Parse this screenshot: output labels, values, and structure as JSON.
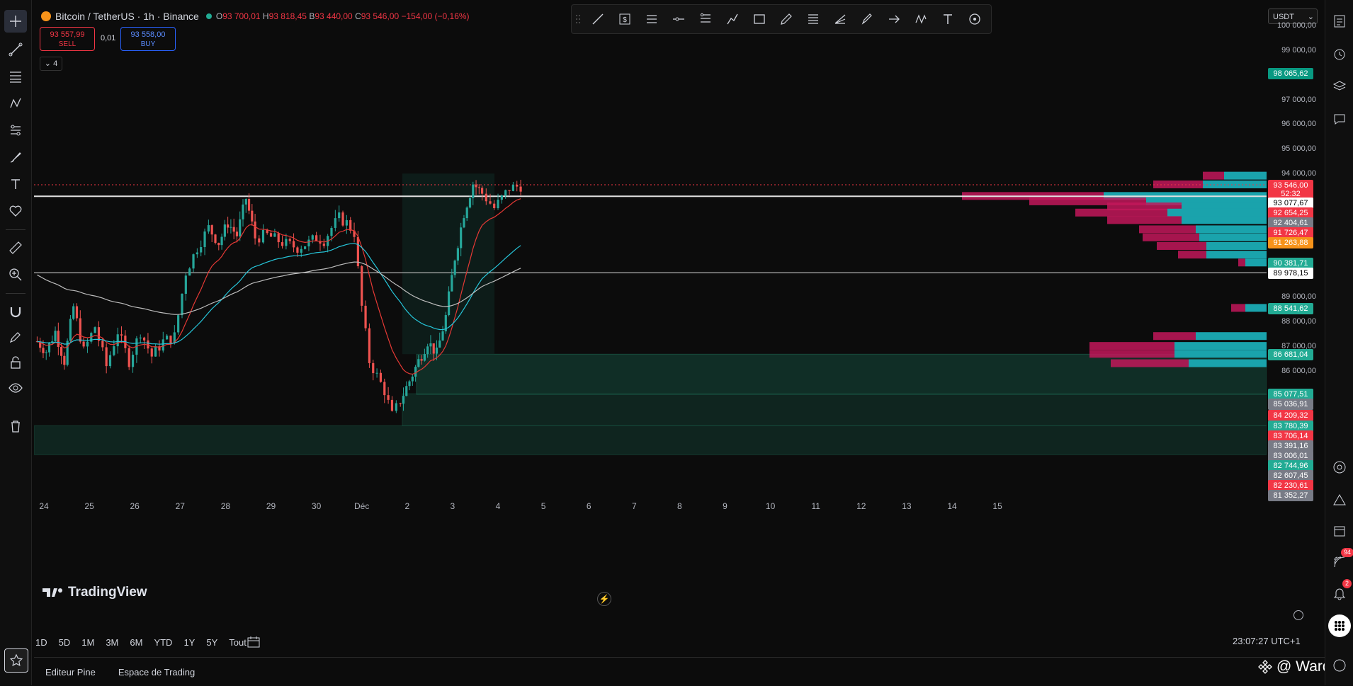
{
  "header": {
    "symbol": "Bitcoin / TetherUS · 1h · Binance",
    "open_label": "O",
    "open": "93 700,01",
    "high_label": "H",
    "high": "93 818,45",
    "low_label": "B",
    "low": "93 440,00",
    "close_label": "C",
    "close": "93 546,00",
    "change": "−154,00 (−0,16%)"
  },
  "trade": {
    "sell_price": "93 557,99",
    "sell_label": "SELL",
    "spread": "0,01",
    "buy_price": "93 558,00",
    "buy_label": "BUY"
  },
  "indicators_toggle": "4",
  "currency": "USDT",
  "price_axis": {
    "ticks": [
      "100 000,00",
      "99 000,00",
      "97 000,00",
      "96 000,00",
      "95 000,00",
      "94 000,00",
      "89 000,00",
      "88 000,00",
      "87 000,00",
      "86 000,00"
    ],
    "labels": [
      {
        "text": "98 065,62",
        "color": "#089981"
      },
      {
        "text": "93 546,00",
        "color": "#f23645"
      },
      {
        "text": "52:32",
        "color": "#f23645"
      },
      {
        "text": "93 077,67",
        "color": "#ffffff"
      },
      {
        "text": "92 654,25",
        "color": "#f23645"
      },
      {
        "text": "92 404,61",
        "color": "#787b86"
      },
      {
        "text": "91 726,47",
        "color": "#f23645"
      },
      {
        "text": "91 263,88",
        "color": "#f7931a"
      },
      {
        "text": "90 381,71",
        "color": "#22ab94"
      },
      {
        "text": "89 978,15",
        "color": "#ffffff"
      },
      {
        "text": "88 541,62",
        "color": "#22ab94"
      },
      {
        "text": "86 681,04",
        "color": "#22ab94"
      },
      {
        "text": "85 077,51",
        "color": "#22ab94"
      },
      {
        "text": "85 036,91",
        "color": "#787b86"
      },
      {
        "text": "84 209,32",
        "color": "#f23645"
      },
      {
        "text": "83 780,39",
        "color": "#22ab94"
      },
      {
        "text": "83 706,14",
        "color": "#f23645"
      },
      {
        "text": "83 391,16",
        "color": "#787b86"
      },
      {
        "text": "83 006,01",
        "color": "#787b86"
      },
      {
        "text": "82 744,96",
        "color": "#22ab94"
      },
      {
        "text": "82 607,45",
        "color": "#787b86"
      },
      {
        "text": "82 230,61",
        "color": "#f23645"
      },
      {
        "text": "81 352,27",
        "color": "#787b86"
      }
    ]
  },
  "time_axis": [
    "24",
    "25",
    "26",
    "27",
    "28",
    "29",
    "30",
    "Déc",
    "2",
    "3",
    "4",
    "5",
    "6",
    "7",
    "8",
    "9",
    "10",
    "11",
    "12",
    "13",
    "14",
    "15"
  ],
  "range_buttons": [
    "1D",
    "5D",
    "1M",
    "3M",
    "6M",
    "YTD",
    "1Y",
    "5Y",
    "Tout"
  ],
  "clock": "23:07:27 UTC+1",
  "bottom_tabs": [
    "Editeur Pine",
    "Espace de Trading"
  ],
  "brand": "TradingView",
  "watermark": "@ Wardil",
  "badges": {
    "ideas": "94",
    "alerts": "2"
  },
  "colors": {
    "up": "#26a69a",
    "down": "#ef5350",
    "bg": "#0c0c0c",
    "accent": "#2962ff"
  },
  "chart_data": {
    "type": "candlestick",
    "symbol": "BTCUSDT",
    "interval": "1h",
    "ylim": [
      81352.27,
      100000
    ],
    "x_ticks": [
      "24",
      "25",
      "26",
      "27",
      "28",
      "29",
      "30",
      "Déc",
      "2",
      "3",
      "4"
    ],
    "price_path": [
      [
        "24",
        87200
      ],
      [
        "24",
        86800
      ],
      [
        "24",
        87600
      ],
      [
        "24",
        86400
      ],
      [
        "24",
        88600
      ],
      [
        "25",
        86800
      ],
      [
        "25",
        87800
      ],
      [
        "25",
        86200
      ],
      [
        "25",
        87600
      ],
      [
        "26",
        86400
      ],
      [
        "26",
        87600
      ],
      [
        "26",
        86600
      ],
      [
        "26",
        87200
      ],
      [
        "27",
        87400
      ],
      [
        "27",
        90000
      ],
      [
        "27",
        91000
      ],
      [
        "27",
        91800
      ],
      [
        "28",
        91200
      ],
      [
        "28",
        92000
      ],
      [
        "28",
        91500
      ],
      [
        "28",
        93000
      ],
      [
        "28",
        91400
      ],
      [
        "29",
        91500
      ],
      [
        "29",
        91200
      ],
      [
        "29",
        91000
      ],
      [
        "30",
        91200
      ],
      [
        "30",
        91400
      ],
      [
        "30",
        91300
      ],
      [
        "30",
        91800
      ],
      [
        "30",
        92200
      ],
      [
        "30",
        92000
      ],
      [
        "Déc",
        91600
      ],
      [
        "Déc",
        88600
      ],
      [
        "Déc",
        86400
      ],
      [
        "Déc",
        85800
      ],
      [
        "Déc",
        85200
      ],
      [
        "Déc",
        84200
      ],
      [
        "2",
        84800
      ],
      [
        "2",
        85600
      ],
      [
        "2",
        86400
      ],
      [
        "2",
        87200
      ],
      [
        "2",
        86700
      ],
      [
        "3",
        88200
      ],
      [
        "3",
        90600
      ],
      [
        "3",
        92400
      ],
      [
        "3",
        93600
      ],
      [
        "3",
        93200
      ],
      [
        "4",
        92600
      ],
      [
        "4",
        93400
      ],
      [
        "4",
        93546
      ]
    ],
    "horizontal_levels": [
      93077.67,
      89978.15
    ],
    "zones": [
      [
        85036.91,
        86681.04
      ],
      [
        83780.39,
        85077.51
      ],
      [
        82607.45,
        83780.39
      ]
    ],
    "volume_profile": [
      {
        "price": 93900,
        "up": 60,
        "down": 30
      },
      {
        "price": 93546,
        "up": 90,
        "down": 70
      },
      {
        "price": 93077,
        "up": 230,
        "down": 200
      },
      {
        "price": 92860,
        "up": 170,
        "down": 165
      },
      {
        "price": 92654,
        "up": 120,
        "down": 105
      },
      {
        "price": 92404,
        "up": 140,
        "down": 130
      },
      {
        "price": 92100,
        "up": 120,
        "down": 105
      },
      {
        "price": 91726,
        "up": 100,
        "down": 80
      },
      {
        "price": 91400,
        "up": 95,
        "down": 80
      },
      {
        "price": 91050,
        "up": 85,
        "down": 70
      },
      {
        "price": 90700,
        "up": 85,
        "down": 40
      },
      {
        "price": 90381,
        "up": 30,
        "down": 10
      },
      {
        "price": 88541,
        "up": 30,
        "down": 20
      },
      {
        "price": 87400,
        "up": 100,
        "down": 60
      },
      {
        "price": 87000,
        "up": 130,
        "down": 120
      },
      {
        "price": 86681,
        "up": 130,
        "down": 120
      },
      {
        "price": 86300,
        "up": 110,
        "down": 110
      }
    ]
  }
}
